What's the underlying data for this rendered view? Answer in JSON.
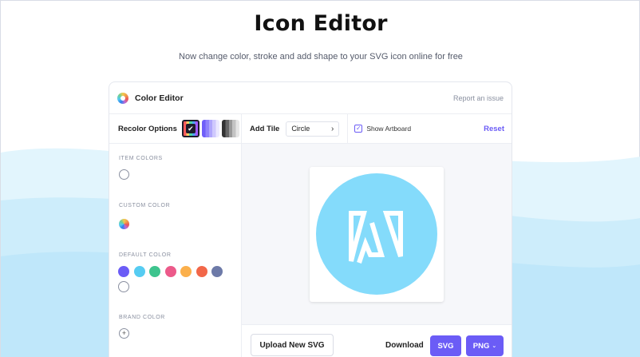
{
  "hero": {
    "title": "Icon Editor",
    "subtitle": "Now change color, stroke and add shape to your SVG icon online for free"
  },
  "editor": {
    "title": "Color Editor",
    "report_link": "Report an issue",
    "logo_icon": "color-wheel-icon"
  },
  "recolor": {
    "label": "Recolor Options",
    "options": [
      {
        "name": "multicolor",
        "selected": true
      },
      {
        "name": "purple-shades",
        "selected": false
      },
      {
        "name": "gray-shades",
        "selected": false
      }
    ],
    "check_glyph": "✔"
  },
  "sidebar": {
    "item_colors_label": "ITEM COLORS",
    "custom_color_label": "CUSTOM COLOR",
    "default_color_label": "DEFAULT COLOR",
    "brand_color_label": "BRAND COLOR",
    "add_glyph": "+",
    "default_colors": [
      "#6b5cf6",
      "#56ccf2",
      "#3ec48e",
      "#ec5a8a",
      "#fbb04c",
      "#f26749",
      "#6d7aa8"
    ]
  },
  "toolbar": {
    "add_tile_label": "Add Tile",
    "tile_value": "Circle",
    "tile_chevron": "›",
    "artboard_label": "Show Artboard",
    "artboard_checked": true,
    "artboard_glyph": "✓",
    "reset_label": "Reset"
  },
  "preview": {
    "tile_color": "#84dbfb",
    "icon_color": "#ffffff",
    "icon_name": "adobe-acrobat-icon"
  },
  "footer": {
    "upload_label": "Upload New SVG",
    "download_label": "Download",
    "svg_label": "SVG",
    "png_label": "PNG",
    "png_chevron": "⌄"
  },
  "colors": {
    "accent": "#6b5cf6",
    "wave_light": "#e0f4fd",
    "wave_mid": "#c9ecfb"
  }
}
